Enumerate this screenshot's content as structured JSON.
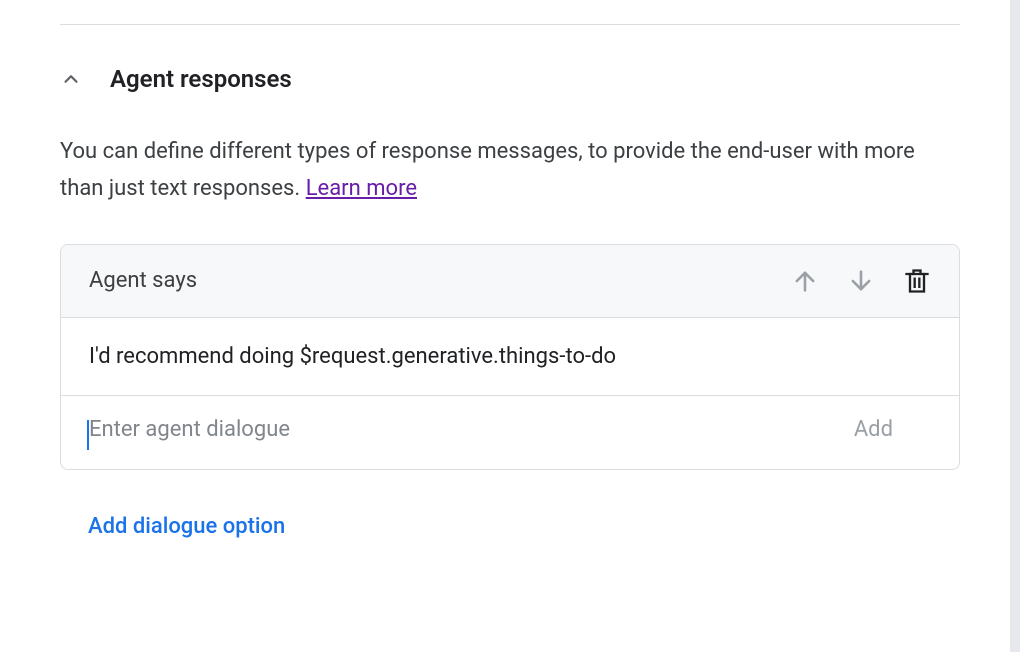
{
  "section": {
    "title": "Agent responses",
    "description_prefix": "You can define different types of response messages, to provide the end-user with more than just text responses. ",
    "learn_more": "Learn more"
  },
  "card": {
    "header": "Agent says",
    "rows": [
      "I'd recommend doing $request.generative.things-to-do"
    ],
    "input_placeholder": "Enter agent dialogue",
    "add_label": "Add"
  },
  "actions": {
    "add_dialogue_option": "Add dialogue option"
  }
}
